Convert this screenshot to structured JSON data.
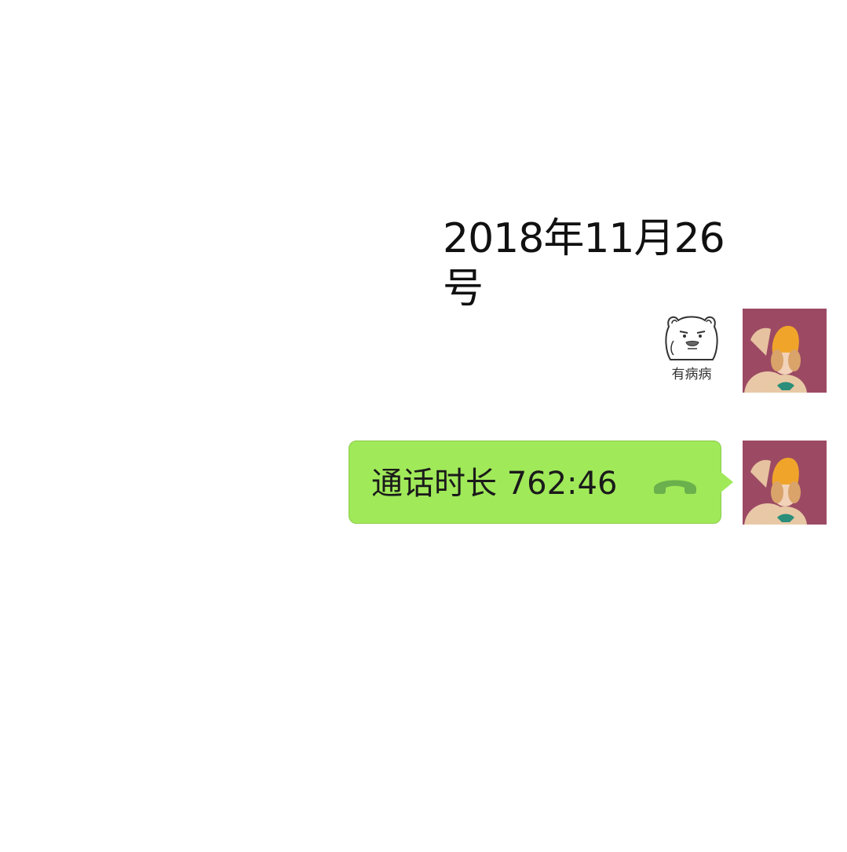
{
  "chat": {
    "date_header": "2018年11月26号",
    "messages": [
      {
        "type": "sticker",
        "sender": "self",
        "caption": "有病病",
        "icon": "bear-sticker-icon"
      },
      {
        "type": "call",
        "sender": "self",
        "label": "通话时长 762:46",
        "icon": "phone-hangup-icon"
      }
    ]
  },
  "colors": {
    "bubble": "#a0e959",
    "avatar_bg": "#9c4a63",
    "phone_icon": "#6ab04c"
  }
}
